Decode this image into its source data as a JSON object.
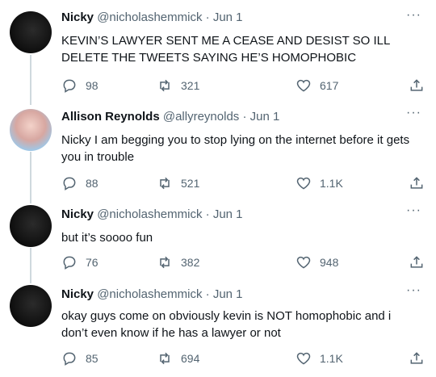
{
  "tweets": [
    {
      "name": "Nicky",
      "handle": "@nicholashemmick",
      "date": "Jun 1",
      "text": "KEVIN’S LAWYER SENT ME A CEASE AND DESIST SO ILL DELETE THE TWEETS SAYING HE’S HOMOPHOBIC",
      "replies": "98",
      "retweets": "321",
      "likes": "617"
    },
    {
      "name": "Allison Reynolds",
      "handle": "@allyreynolds",
      "date": "Jun 1",
      "text": "Nicky I am begging you to stop lying on the internet before it gets you in trouble",
      "replies": "88",
      "retweets": "521",
      "likes": "1.1K"
    },
    {
      "name": "Nicky",
      "handle": "@nicholashemmick",
      "date": "Jun 1",
      "text": "but it’s soooo fun",
      "replies": "76",
      "retweets": "382",
      "likes": "948"
    },
    {
      "name": "Nicky",
      "handle": "@nicholashemmick",
      "date": "Jun 1",
      "text": "okay guys come on obviously kevin is NOT homophobic and i don’t even know if he has a lawyer or not",
      "replies": "85",
      "retweets": "694",
      "likes": "1.1K"
    }
  ],
  "separator": "·",
  "more_glyph": "···",
  "colors": {
    "text": "#0f1419",
    "secondary": "#536471",
    "thread_line": "#cfd9de"
  }
}
